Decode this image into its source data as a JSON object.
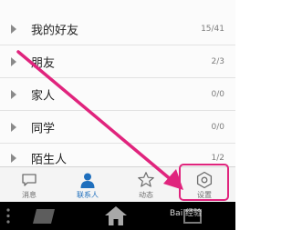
{
  "groups": [
    {
      "name": "我的好友",
      "count": "15/41"
    },
    {
      "name": "朋友",
      "count": "2/3"
    },
    {
      "name": "家人",
      "count": "0/0"
    },
    {
      "name": "同学",
      "count": "0/0"
    },
    {
      "name": "陌生人",
      "count": "1/2"
    }
  ],
  "tabs": [
    {
      "label": "消息",
      "icon": "message-icon"
    },
    {
      "label": "联系人",
      "icon": "contacts-icon"
    },
    {
      "label": "动态",
      "icon": "star-icon"
    },
    {
      "label": "设置",
      "icon": "gear-icon"
    }
  ],
  "active_tab": "联系人",
  "watermark": "Bai 经验",
  "colors": {
    "accent": "#1f6fbd",
    "annotation": "#e0247d",
    "nav_bar": "#000000"
  }
}
